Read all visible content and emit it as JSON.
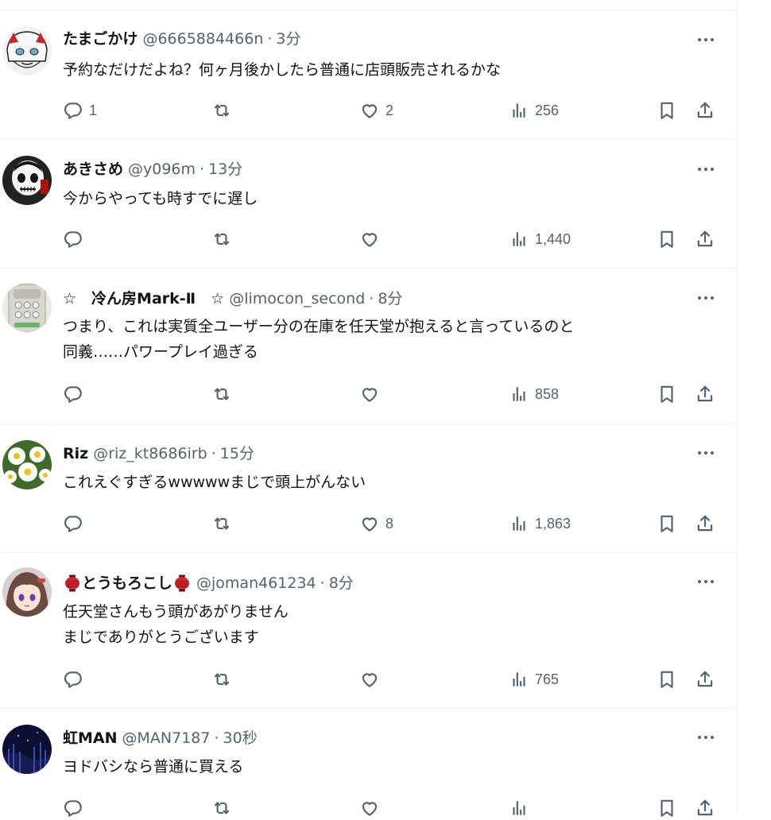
{
  "tweets": [
    {
      "name": "たまごかけ",
      "handle": "@6665884466n",
      "time": "3分",
      "lines": [
        "予約なだけだよね？何ヶ月後かしたら普通に店頭販売されるかな"
      ],
      "reply_count": "1",
      "retweet_count": "",
      "like_count": "2",
      "view_count": "256",
      "avatar": "drawn-character-face"
    },
    {
      "name": "あきさめ",
      "handle": "@y096m",
      "time": "13分",
      "lines": [
        "今からやっても時すでに遅し"
      ],
      "reply_count": "",
      "retweet_count": "",
      "like_count": "",
      "view_count": "1,440",
      "avatar": "skull-character"
    },
    {
      "name": "☆　冷ん房Mark-Ⅱ　☆",
      "handle": "@limocon_second",
      "time": "8分",
      "lines": [
        "つまり、これは実質全ユーザー分の在庫を任天堂が抱えると言っているのと",
        "同義……パワープレイ過ぎる"
      ],
      "reply_count": "",
      "retweet_count": "",
      "like_count": "",
      "view_count": "858",
      "avatar": "remote-control"
    },
    {
      "name": "Riz",
      "handle": "@riz_kt8686irb",
      "time": "15分",
      "lines": [
        "これえぐすぎるwwwwwまじで頭上がんない"
      ],
      "reply_count": "",
      "retweet_count": "",
      "like_count": "8",
      "view_count": "1,863",
      "avatar": "daisy-flowers"
    },
    {
      "name": "とうもろこし",
      "handle": "@joman461234",
      "time": "8分",
      "lines": [
        "任天堂さんもう頭があがりません",
        "まじでありがとうございます"
      ],
      "reply_count": "",
      "retweet_count": "",
      "like_count": "",
      "view_count": "765",
      "avatar": "anime-girl"
    },
    {
      "name": "虹MAN",
      "handle": "@MAN7187",
      "time": "30秒",
      "lines": [
        "ヨドバシなら普通に買える"
      ],
      "reply_count": "",
      "retweet_count": "",
      "like_count": "",
      "view_count": "",
      "avatar": "dark-forest"
    }
  ],
  "icons": {
    "reply": "reply-icon",
    "retweet": "retweet-icon",
    "like": "like-icon",
    "views": "views-icon",
    "bookmark": "bookmark-icon",
    "share": "share-icon",
    "more": "more-icon"
  },
  "colors": {
    "text": "#0f1419",
    "secondary": "#536471",
    "divider": "#eff3f4"
  }
}
